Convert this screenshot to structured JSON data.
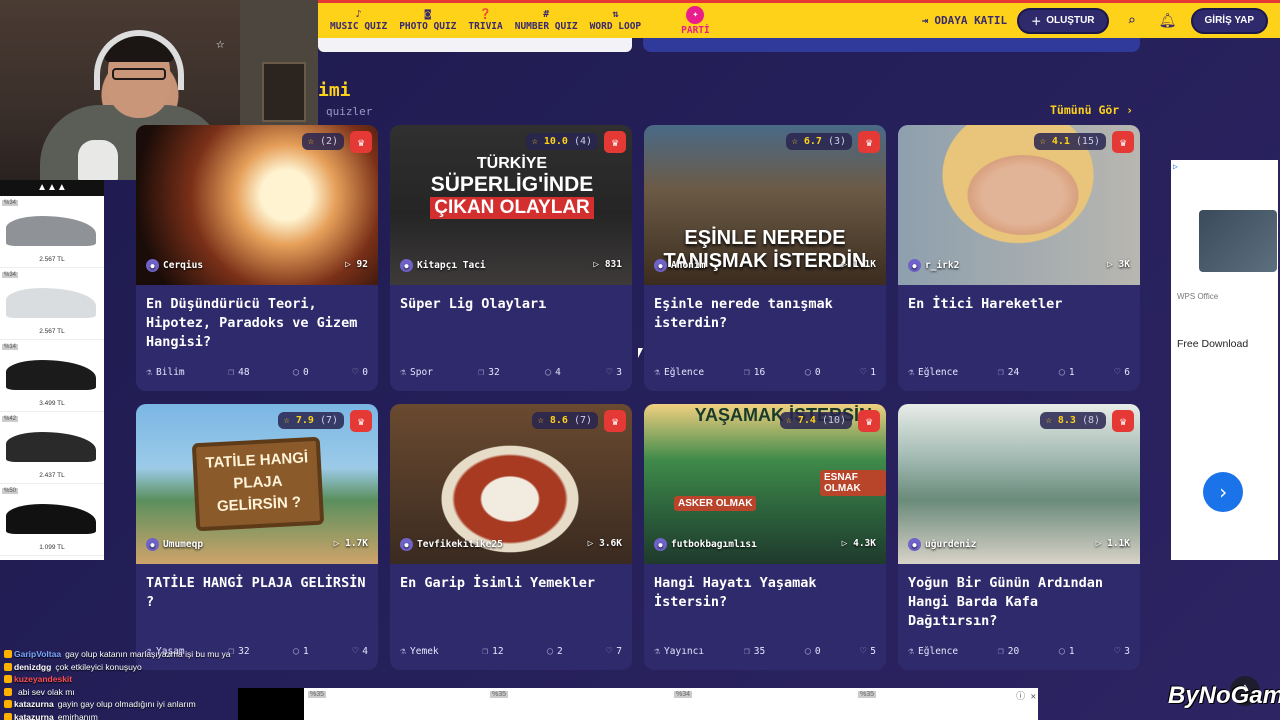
{
  "nav": {
    "items": [
      {
        "icon": "music-note-icon",
        "glyph": "♪",
        "label": "MUSIC QUIZ"
      },
      {
        "icon": "camera-icon",
        "glyph": "◙",
        "label": "PHOTO QUIZ"
      },
      {
        "icon": "chat-bubble-icon",
        "glyph": "❓",
        "label": "TRIVIA"
      },
      {
        "icon": "hash-icon",
        "glyph": "#",
        "label": "NUMBER QUIZ"
      },
      {
        "icon": "loop-icon",
        "glyph": "⇅",
        "label": "WORD LOOP"
      }
    ],
    "parti": {
      "glyph": "✦",
      "label": "PARTİ"
    },
    "join_label": "ODAYA KATIL",
    "create_label": "OLUŞTUR",
    "login_label": "GİRİŞ YAP"
  },
  "section": {
    "title": "imi",
    "subtitle": "quizler",
    "see_all": "Tümünü Gör ›"
  },
  "cards": [
    {
      "rating": "",
      "rating_count": "(2)",
      "author": "Cerqius",
      "plays": "92",
      "title": "En Düşündürücü Teori, Hipotez, Paradoks ve Gizem Hangisi?",
      "category": "Bilim",
      "questions": "48",
      "comments": "0",
      "likes": "0"
    },
    {
      "rating": "10.0",
      "rating_count": "(4)",
      "author": "Kitapçı Taci",
      "plays": "831",
      "title": "Süper Lig Olayları",
      "category": "Spor",
      "questions": "32",
      "comments": "4",
      "likes": "3"
    },
    {
      "rating": "6.7",
      "rating_count": "(3)",
      "author": "Anonim",
      "plays": "1.1K",
      "title": "Eşinle nerede tanışmak isterdin?",
      "category": "Eğlence",
      "questions": "16",
      "comments": "0",
      "likes": "1"
    },
    {
      "rating": "4.1",
      "rating_count": "(15)",
      "author": "r_irk2",
      "plays": "3K",
      "title": "En İtici Hareketler",
      "category": "Eğlence",
      "questions": "24",
      "comments": "1",
      "likes": "6"
    },
    {
      "rating": "7.9",
      "rating_count": "(7)",
      "author": "Umumeqp",
      "plays": "1.7K",
      "title": "TATİLE HANGİ PLAJA GELİRSİN ?",
      "category": "Yaşam",
      "questions": "32",
      "comments": "1",
      "likes": "4"
    },
    {
      "rating": "8.6",
      "rating_count": "(7)",
      "author": "Tevfikekitike25",
      "plays": "3.6K",
      "title": "En Garip İsimli Yemekler",
      "category": "Yemek",
      "questions": "12",
      "comments": "2",
      "likes": "7"
    },
    {
      "rating": "7.4",
      "rating_count": "(10)",
      "author": "futbokbagımlısı",
      "plays": "4.3K",
      "title": "Hangi Hayatı Yaşamak İstersin?",
      "category": "Yayıncı",
      "questions": "35",
      "comments": "0",
      "likes": "5"
    },
    {
      "rating": "8.3",
      "rating_count": "(8)",
      "author": "uğurdeniz",
      "plays": "1.1K",
      "title": "Yoğun Bir Günün Ardından Hangi Barda Kafa Dağıtırsın?",
      "category": "Eğlence",
      "questions": "20",
      "comments": "1",
      "likes": "3"
    }
  ],
  "thumb_text": {
    "card2_line1": "TÜRKİYE",
    "card2_line2": "SÜPERLİG'İNDE",
    "card2_line3": "ÇIKAN OLAYLAR",
    "card3_line": "EŞİNLE NEREDE TANIŞMAK İSTERDİN",
    "card5_sign": "TATİLE HANGİ PLAJA GELİRSİN ?",
    "card7_head": "YAŞAMAK İSTERSİN",
    "card7_tag1": "ESNAF OLMAK",
    "card7_tag2": "ASKER OLMAK"
  },
  "left_ad": {
    "brand": "adidas",
    "items": [
      {
        "badge": "%34",
        "price": "2.567 TL",
        "color": "#8f9397"
      },
      {
        "badge": "%34",
        "price": "2.567 TL",
        "color": "#d9dde0"
      },
      {
        "badge": "%14",
        "price": "3.499 TL",
        "color": "#1b1b1b"
      },
      {
        "badge": "%42",
        "price": "2.437 TL",
        "color": "#2a2a2a"
      },
      {
        "badge": "%50",
        "price": "1.099 TL",
        "color": "#111111"
      }
    ]
  },
  "right_ad": {
    "brand": "WPS Office",
    "cta": "Free Download"
  },
  "bottom_ad": {
    "badges": [
      "%35",
      "%35",
      "%34",
      "%35"
    ]
  },
  "chat": [
    {
      "user": "GaripVoltaa",
      "color": "#7aa8ff",
      "text": "gay olup katanın marlaşıyazma işi bu mu ya"
    },
    {
      "user": "denizdgg",
      "color": "#ffffff",
      "text": "çok etkileyici konuşuyo"
    },
    {
      "user": "kuzeyandeskit",
      "color": "#ff4d4d",
      "text": ""
    },
    {
      "user": "",
      "color": "#ffffff",
      "text": "abi sev olak mı"
    },
    {
      "user": "katazurna",
      "color": "#ffffff",
      "text": "gayin gay olup olmadığını iyi anlarım"
    },
    {
      "user": "katazurna",
      "color": "#ffffff",
      "text": "emirhanım"
    }
  ],
  "watermark": "ByNoGame"
}
